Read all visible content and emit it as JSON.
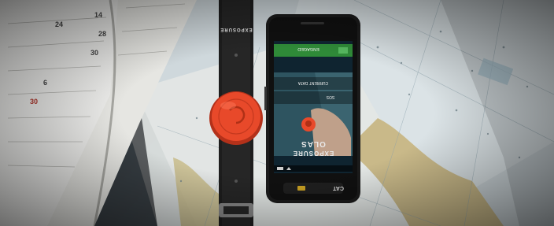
{
  "photo": {
    "subject": "wristband beacon and rugged smartphone on nautical charts",
    "colors": {
      "beacon_orange": "#e8492a",
      "app_green": "#2f8a38",
      "chart_paper": "#d9dfe2",
      "phone_body": "#1b1b1b"
    },
    "phone": {
      "app_header": "ENGAGED",
      "menu_items": [
        "CURRENT DATA",
        "SOS"
      ],
      "brand_logo": "EXPOSURE",
      "brand_sub": "OLAS",
      "status_icons": [
        "battery-icon",
        "wifi-icon"
      ],
      "maker_badge": "CAT"
    },
    "watch_strap_text": "EXPOSURE",
    "book": {
      "numbers_visible": [
        "14",
        "28",
        "30",
        "24",
        "6",
        "30"
      ]
    }
  }
}
